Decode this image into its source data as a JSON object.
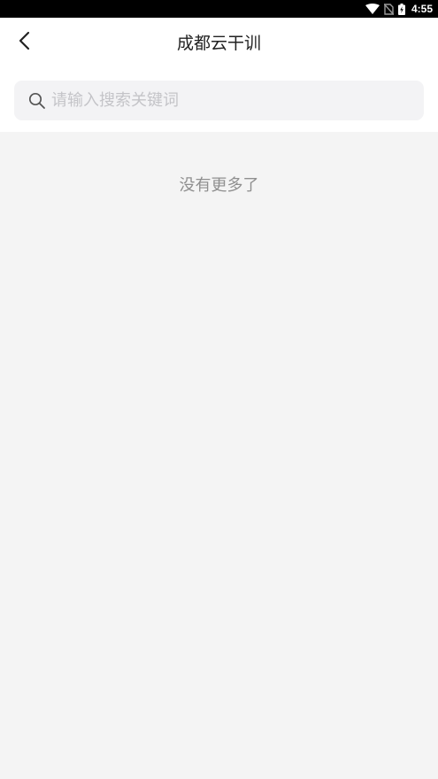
{
  "status_bar": {
    "time": "4:55",
    "icons": [
      "wifi-icon",
      "no-sim-icon",
      "battery-charging-icon"
    ]
  },
  "header": {
    "title": "成都云干训",
    "back_icon": "chevron-left-icon"
  },
  "search": {
    "placeholder": "请输入搜索关键词",
    "value": "",
    "icon": "search-icon"
  },
  "list": {
    "footer_text": "没有更多了"
  },
  "colors": {
    "page_background": "#f4f4f4",
    "header_background": "#ffffff",
    "search_background": "#f3f3f5",
    "placeholder": "#c4c4c8",
    "footer_text": "#8f8f8f"
  }
}
